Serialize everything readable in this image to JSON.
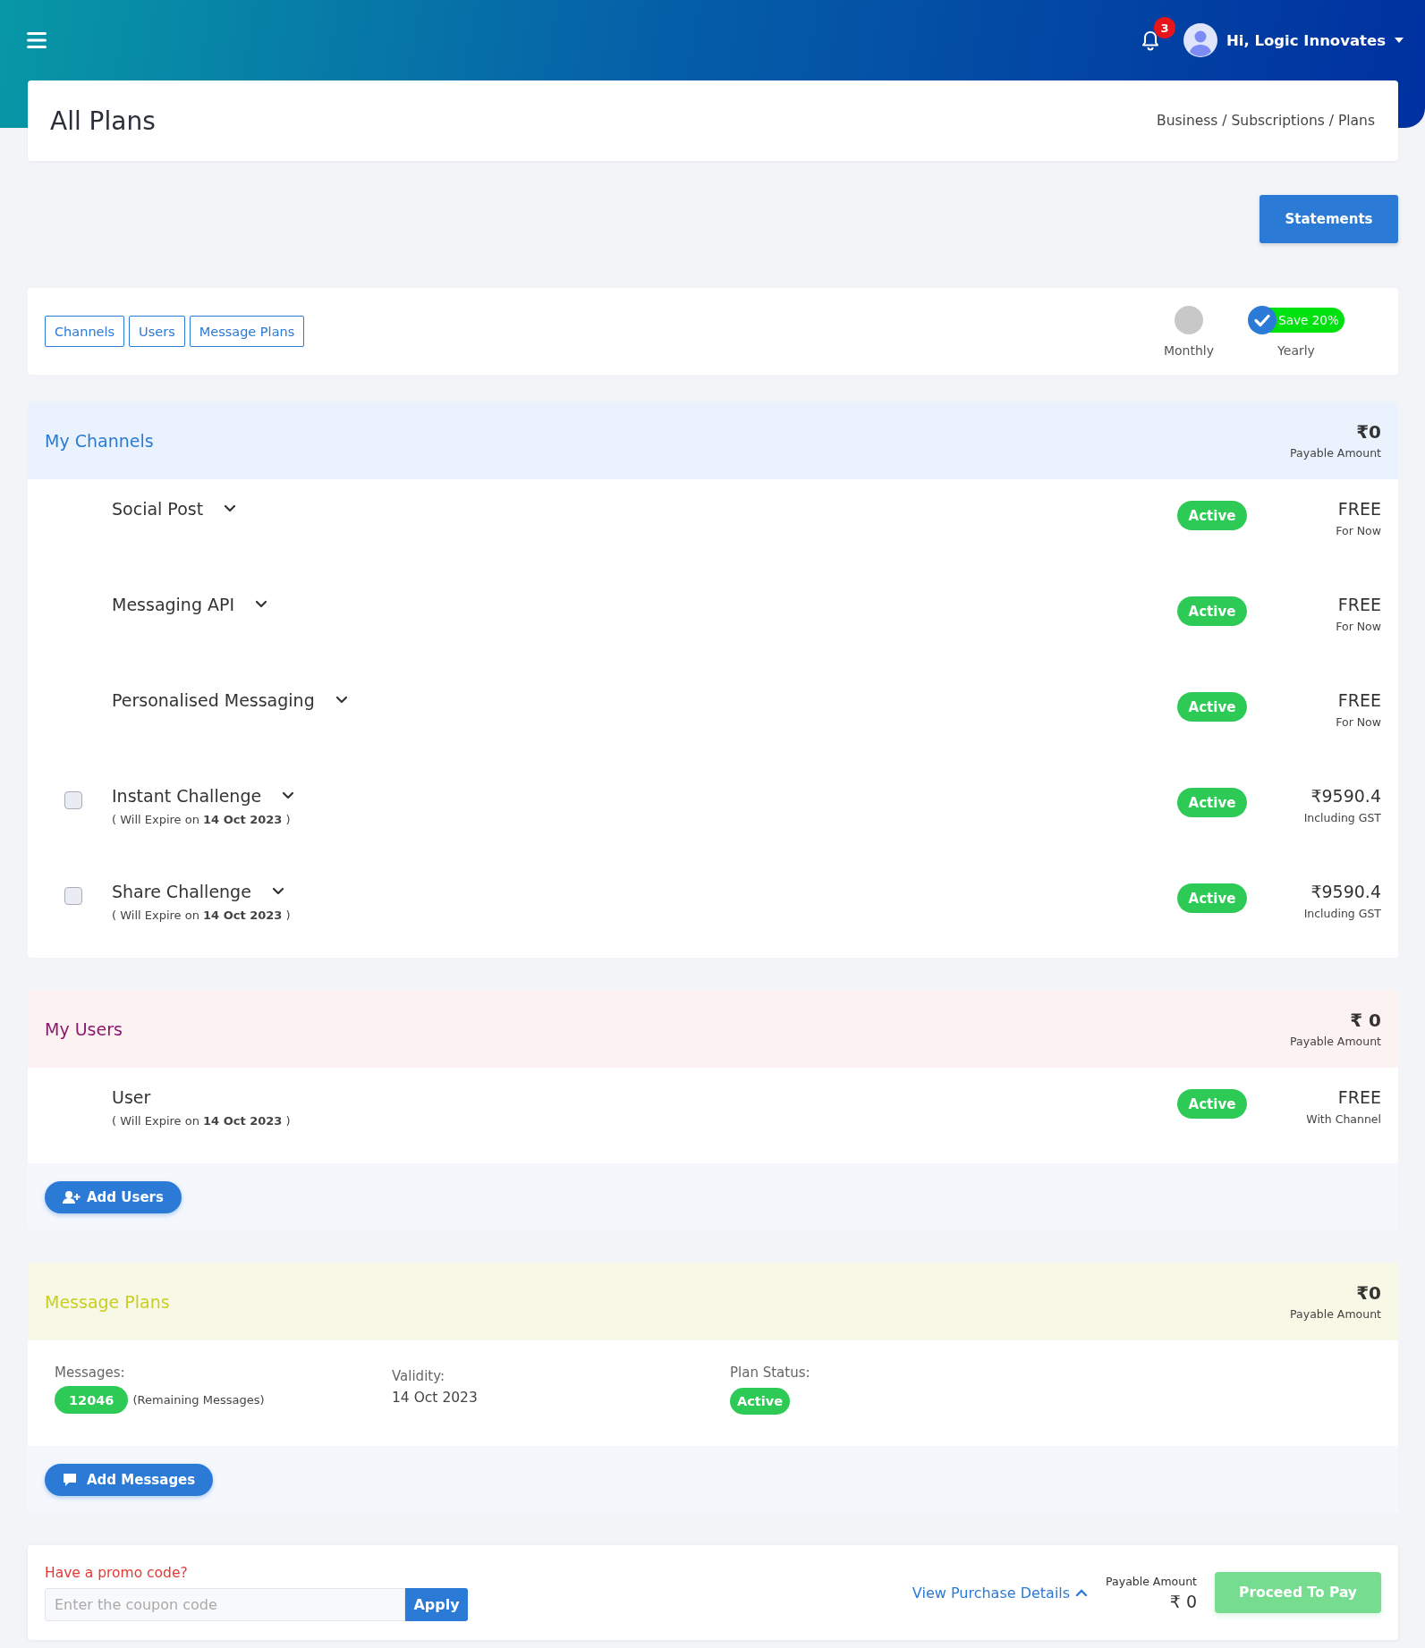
{
  "header": {
    "notification_count": "3",
    "user_name": "Hi, Logic Innovates"
  },
  "page": {
    "title": "All Plans",
    "breadcrumb": "Business / Subscriptions / Plans"
  },
  "statements_button": "Statements",
  "filter_tabs": [
    {
      "label": "Channels"
    },
    {
      "label": "Users"
    },
    {
      "label": "Message Plans"
    }
  ],
  "billing": [
    {
      "label": "Monthly",
      "selected": false
    },
    {
      "label": "Yearly",
      "selected": true,
      "badge": "Save 20%"
    }
  ],
  "sections": [
    {
      "kind": "channels",
      "title": "My Channels",
      "amount": "₹0",
      "amount_label": "Payable Amount",
      "rows": [
        {
          "name": "Social Post",
          "expandable": true,
          "status": "Active",
          "price": "FREE",
          "price_note": "For Now"
        },
        {
          "name": "Messaging API",
          "expandable": true,
          "status": "Active",
          "price": "FREE",
          "price_note": "For Now"
        },
        {
          "name": "Personalised Messaging",
          "expandable": true,
          "status": "Active",
          "price": "FREE",
          "price_note": "For Now"
        },
        {
          "name": "Instant Challenge",
          "expandable": true,
          "checkbox": true,
          "checked": false,
          "expiry": "( Will Expire on **14 Oct 2023** )",
          "status": "Active",
          "price": "₹9590.4",
          "price_note": "Including GST"
        },
        {
          "name": "Share Challenge",
          "expandable": true,
          "checkbox": true,
          "checked": false,
          "expiry": "( Will Expire on **14 Oct 2023** )",
          "status": "Active",
          "price": "₹9590.4",
          "price_note": "Including GST"
        }
      ]
    },
    {
      "kind": "users",
      "title": "My Users",
      "amount": "₹ 0",
      "amount_label": "Payable Amount",
      "rows": [
        {
          "name": "User",
          "expiry": "( Will Expire on **14 Oct 2023** )",
          "status": "Active",
          "price": "FREE",
          "price_note": "With Channel"
        }
      ],
      "action": {
        "kind": "add-user",
        "label": "Add Users"
      }
    },
    {
      "kind": "messages",
      "title": "Message Plans",
      "amount": "₹0",
      "amount_label": "Payable Amount",
      "details": {
        "messages_label": "Messages:",
        "messages_count": "12046",
        "messages_note": "(Remaining Messages)",
        "validity_label": "Validity:",
        "validity": "14 Oct 2023",
        "status_label": "Plan Status:",
        "status": "Active"
      },
      "action": {
        "kind": "add-message",
        "label": "Add Messages"
      }
    }
  ],
  "promo": {
    "label": "Have a promo code?",
    "placeholder": "Enter the coupon code",
    "apply": "Apply",
    "details_link": "View Purchase Details",
    "payable_label": "Payable Amount",
    "payable_amount": "₹ 0",
    "pay_button": "Proceed To Pay",
    "pay_disabled": true
  }
}
